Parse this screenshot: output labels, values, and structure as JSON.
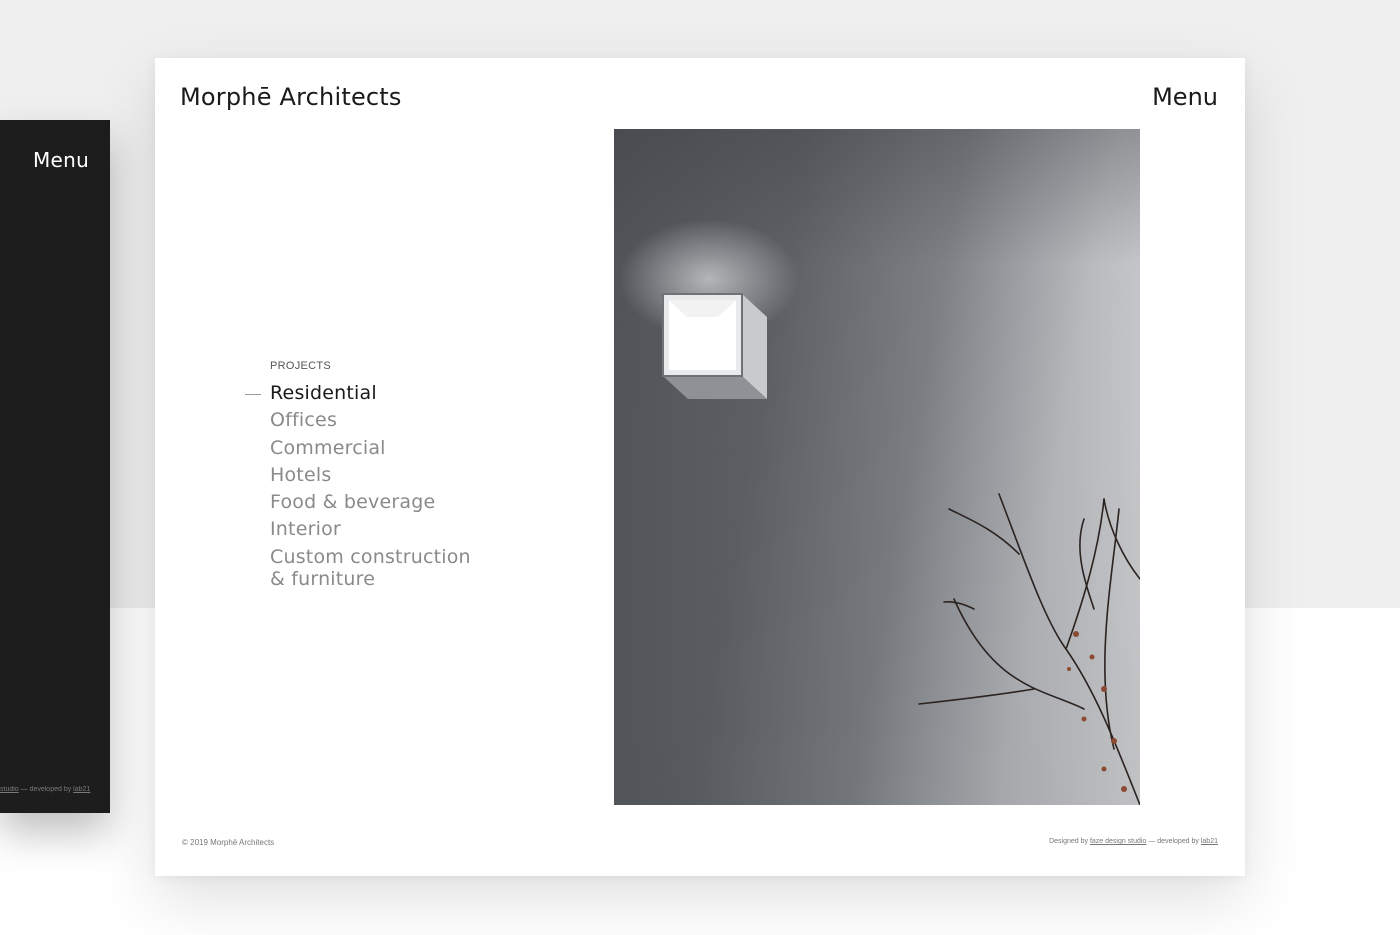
{
  "side_panel": {
    "menu_label": "Menu",
    "footer_partial_link": "studio",
    "footer_mid": " — developed by ",
    "footer_dev_link": "lab21"
  },
  "header": {
    "brand": "Morphē Architects",
    "menu_label": "Menu"
  },
  "projects": {
    "section_label": "PROJECTS",
    "items": [
      {
        "label": "Residential",
        "active": true
      },
      {
        "label": "Offices"
      },
      {
        "label": "Commercial"
      },
      {
        "label": "Hotels"
      },
      {
        "label": "Food & beverage"
      },
      {
        "label": "Interior"
      },
      {
        "label_line1": "Custom construction",
        "label_line2": "& furniture"
      }
    ]
  },
  "footer": {
    "copyright": "© 2019 Morphē Architects",
    "designed_by": "Designed by ",
    "designer_link": "faze design studio",
    "developed_by": " — developed by ",
    "developer_link": "lab21"
  },
  "colors": {
    "active_text": "#1a1a1a",
    "inactive_text": "#8a8a8a",
    "dark_panel": "#1d1d1d"
  }
}
